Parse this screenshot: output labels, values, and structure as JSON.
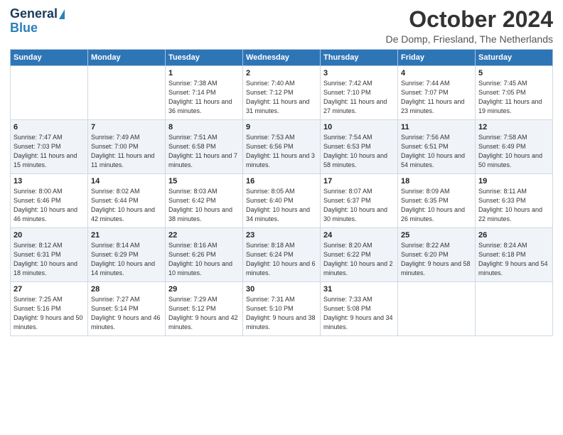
{
  "header": {
    "logo_line1": "General",
    "logo_line2": "Blue",
    "title": "October 2024",
    "location": "De Domp, Friesland, The Netherlands"
  },
  "days_of_week": [
    "Sunday",
    "Monday",
    "Tuesday",
    "Wednesday",
    "Thursday",
    "Friday",
    "Saturday"
  ],
  "weeks": [
    [
      {
        "day": "",
        "sunrise": "",
        "sunset": "",
        "daylight": ""
      },
      {
        "day": "",
        "sunrise": "",
        "sunset": "",
        "daylight": ""
      },
      {
        "day": "1",
        "sunrise": "Sunrise: 7:38 AM",
        "sunset": "Sunset: 7:14 PM",
        "daylight": "Daylight: 11 hours and 36 minutes."
      },
      {
        "day": "2",
        "sunrise": "Sunrise: 7:40 AM",
        "sunset": "Sunset: 7:12 PM",
        "daylight": "Daylight: 11 hours and 31 minutes."
      },
      {
        "day": "3",
        "sunrise": "Sunrise: 7:42 AM",
        "sunset": "Sunset: 7:10 PM",
        "daylight": "Daylight: 11 hours and 27 minutes."
      },
      {
        "day": "4",
        "sunrise": "Sunrise: 7:44 AM",
        "sunset": "Sunset: 7:07 PM",
        "daylight": "Daylight: 11 hours and 23 minutes."
      },
      {
        "day": "5",
        "sunrise": "Sunrise: 7:45 AM",
        "sunset": "Sunset: 7:05 PM",
        "daylight": "Daylight: 11 hours and 19 minutes."
      }
    ],
    [
      {
        "day": "6",
        "sunrise": "Sunrise: 7:47 AM",
        "sunset": "Sunset: 7:03 PM",
        "daylight": "Daylight: 11 hours and 15 minutes."
      },
      {
        "day": "7",
        "sunrise": "Sunrise: 7:49 AM",
        "sunset": "Sunset: 7:00 PM",
        "daylight": "Daylight: 11 hours and 11 minutes."
      },
      {
        "day": "8",
        "sunrise": "Sunrise: 7:51 AM",
        "sunset": "Sunset: 6:58 PM",
        "daylight": "Daylight: 11 hours and 7 minutes."
      },
      {
        "day": "9",
        "sunrise": "Sunrise: 7:53 AM",
        "sunset": "Sunset: 6:56 PM",
        "daylight": "Daylight: 11 hours and 3 minutes."
      },
      {
        "day": "10",
        "sunrise": "Sunrise: 7:54 AM",
        "sunset": "Sunset: 6:53 PM",
        "daylight": "Daylight: 10 hours and 58 minutes."
      },
      {
        "day": "11",
        "sunrise": "Sunrise: 7:56 AM",
        "sunset": "Sunset: 6:51 PM",
        "daylight": "Daylight: 10 hours and 54 minutes."
      },
      {
        "day": "12",
        "sunrise": "Sunrise: 7:58 AM",
        "sunset": "Sunset: 6:49 PM",
        "daylight": "Daylight: 10 hours and 50 minutes."
      }
    ],
    [
      {
        "day": "13",
        "sunrise": "Sunrise: 8:00 AM",
        "sunset": "Sunset: 6:46 PM",
        "daylight": "Daylight: 10 hours and 46 minutes."
      },
      {
        "day": "14",
        "sunrise": "Sunrise: 8:02 AM",
        "sunset": "Sunset: 6:44 PM",
        "daylight": "Daylight: 10 hours and 42 minutes."
      },
      {
        "day": "15",
        "sunrise": "Sunrise: 8:03 AM",
        "sunset": "Sunset: 6:42 PM",
        "daylight": "Daylight: 10 hours and 38 minutes."
      },
      {
        "day": "16",
        "sunrise": "Sunrise: 8:05 AM",
        "sunset": "Sunset: 6:40 PM",
        "daylight": "Daylight: 10 hours and 34 minutes."
      },
      {
        "day": "17",
        "sunrise": "Sunrise: 8:07 AM",
        "sunset": "Sunset: 6:37 PM",
        "daylight": "Daylight: 10 hours and 30 minutes."
      },
      {
        "day": "18",
        "sunrise": "Sunrise: 8:09 AM",
        "sunset": "Sunset: 6:35 PM",
        "daylight": "Daylight: 10 hours and 26 minutes."
      },
      {
        "day": "19",
        "sunrise": "Sunrise: 8:11 AM",
        "sunset": "Sunset: 6:33 PM",
        "daylight": "Daylight: 10 hours and 22 minutes."
      }
    ],
    [
      {
        "day": "20",
        "sunrise": "Sunrise: 8:12 AM",
        "sunset": "Sunset: 6:31 PM",
        "daylight": "Daylight: 10 hours and 18 minutes."
      },
      {
        "day": "21",
        "sunrise": "Sunrise: 8:14 AM",
        "sunset": "Sunset: 6:29 PM",
        "daylight": "Daylight: 10 hours and 14 minutes."
      },
      {
        "day": "22",
        "sunrise": "Sunrise: 8:16 AM",
        "sunset": "Sunset: 6:26 PM",
        "daylight": "Daylight: 10 hours and 10 minutes."
      },
      {
        "day": "23",
        "sunrise": "Sunrise: 8:18 AM",
        "sunset": "Sunset: 6:24 PM",
        "daylight": "Daylight: 10 hours and 6 minutes."
      },
      {
        "day": "24",
        "sunrise": "Sunrise: 8:20 AM",
        "sunset": "Sunset: 6:22 PM",
        "daylight": "Daylight: 10 hours and 2 minutes."
      },
      {
        "day": "25",
        "sunrise": "Sunrise: 8:22 AM",
        "sunset": "Sunset: 6:20 PM",
        "daylight": "Daylight: 9 hours and 58 minutes."
      },
      {
        "day": "26",
        "sunrise": "Sunrise: 8:24 AM",
        "sunset": "Sunset: 6:18 PM",
        "daylight": "Daylight: 9 hours and 54 minutes."
      }
    ],
    [
      {
        "day": "27",
        "sunrise": "Sunrise: 7:25 AM",
        "sunset": "Sunset: 5:16 PM",
        "daylight": "Daylight: 9 hours and 50 minutes."
      },
      {
        "day": "28",
        "sunrise": "Sunrise: 7:27 AM",
        "sunset": "Sunset: 5:14 PM",
        "daylight": "Daylight: 9 hours and 46 minutes."
      },
      {
        "day": "29",
        "sunrise": "Sunrise: 7:29 AM",
        "sunset": "Sunset: 5:12 PM",
        "daylight": "Daylight: 9 hours and 42 minutes."
      },
      {
        "day": "30",
        "sunrise": "Sunrise: 7:31 AM",
        "sunset": "Sunset: 5:10 PM",
        "daylight": "Daylight: 9 hours and 38 minutes."
      },
      {
        "day": "31",
        "sunrise": "Sunrise: 7:33 AM",
        "sunset": "Sunset: 5:08 PM",
        "daylight": "Daylight: 9 hours and 34 minutes."
      },
      {
        "day": "",
        "sunrise": "",
        "sunset": "",
        "daylight": ""
      },
      {
        "day": "",
        "sunrise": "",
        "sunset": "",
        "daylight": ""
      }
    ]
  ]
}
